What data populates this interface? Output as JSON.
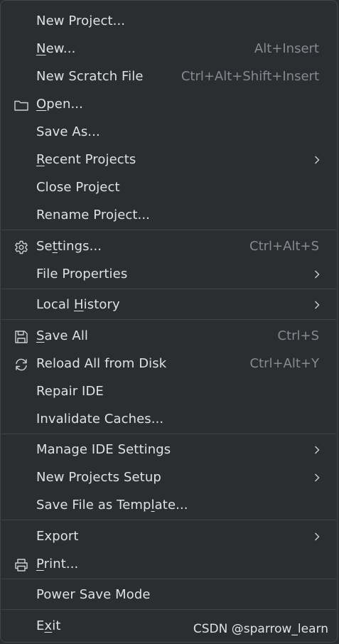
{
  "menu": {
    "new_project": {
      "label": "New Project..."
    },
    "new": {
      "pre": "",
      "mnemonic": "N",
      "post": "ew...",
      "shortcut": "Alt+Insert"
    },
    "new_scratch_file": {
      "label": "New Scratch File",
      "shortcut": "Ctrl+Alt+Shift+Insert"
    },
    "open": {
      "pre": "",
      "mnemonic": "O",
      "post": "pen...",
      "icon": "folder-icon"
    },
    "save_as": {
      "label": "Save As..."
    },
    "recent_projects": {
      "pre": "",
      "mnemonic": "R",
      "post": "ecent Projects"
    },
    "close_project": {
      "label": "Close Project"
    },
    "rename_project": {
      "label": "Rename Project..."
    },
    "settings": {
      "pre": "Se",
      "mnemonic": "t",
      "post": "tings...",
      "shortcut": "Ctrl+Alt+S",
      "icon": "gear-icon"
    },
    "file_properties": {
      "label": "File Properties"
    },
    "local_history": {
      "pre": "Local ",
      "mnemonic": "H",
      "post": "istory"
    },
    "save_all": {
      "pre": "",
      "mnemonic": "S",
      "post": "ave All",
      "shortcut": "Ctrl+S",
      "icon": "save-icon"
    },
    "reload_all": {
      "label": "Reload All from Disk",
      "shortcut": "Ctrl+Alt+Y",
      "icon": "reload-icon"
    },
    "repair_ide": {
      "label": "Repair IDE"
    },
    "invalidate_caches": {
      "label": "Invalidate Caches..."
    },
    "manage_ide_settings": {
      "label": "Manage IDE Settings"
    },
    "new_projects_setup": {
      "label": "New Projects Setup"
    },
    "save_file_as_template": {
      "pre": "Save File as Temp",
      "mnemonic": "l",
      "post": "ate..."
    },
    "export": {
      "label": "Export"
    },
    "print": {
      "pre": "",
      "mnemonic": "P",
      "post": "rint...",
      "icon": "printer-icon"
    },
    "power_save_mode": {
      "label": "Power Save Mode"
    },
    "exit": {
      "pre": "E",
      "mnemonic": "x",
      "post": "it"
    }
  },
  "watermark": "CSDN @sparrow_learn",
  "colors": {
    "background": "#2b2d30",
    "border": "#43454a",
    "text": "#dfe1e5",
    "shortcut_text": "#868a91",
    "icon": "#ced0d6"
  }
}
